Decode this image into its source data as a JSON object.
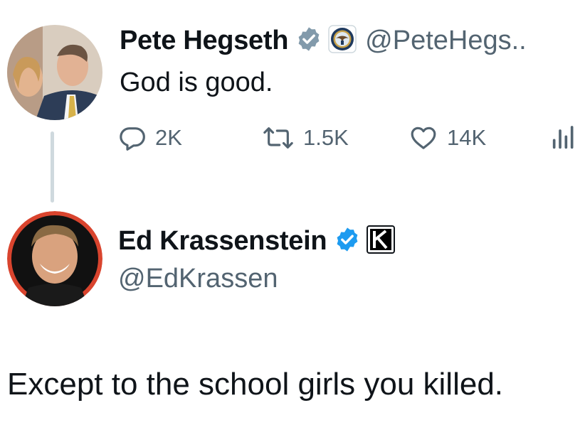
{
  "original_tweet": {
    "author_name": "Pete Hegseth",
    "handle": "@PeteHegs..",
    "text": "God is good.",
    "actions": {
      "replies": "2K",
      "retweets": "1.5K",
      "likes": "14K"
    },
    "verified_badge_color": "#829aab"
  },
  "reply_tweet": {
    "author_name": "Ed Krassenstein",
    "handle": "@EdKrassen",
    "text": "Except to the school girls you killed.",
    "verified_badge_color": "#1d9bf0"
  },
  "icons": [
    "reply-icon",
    "retweet-icon",
    "like-icon",
    "views-icon",
    "verified-icon",
    "affiliate-seal-icon",
    "k-logo-icon"
  ]
}
